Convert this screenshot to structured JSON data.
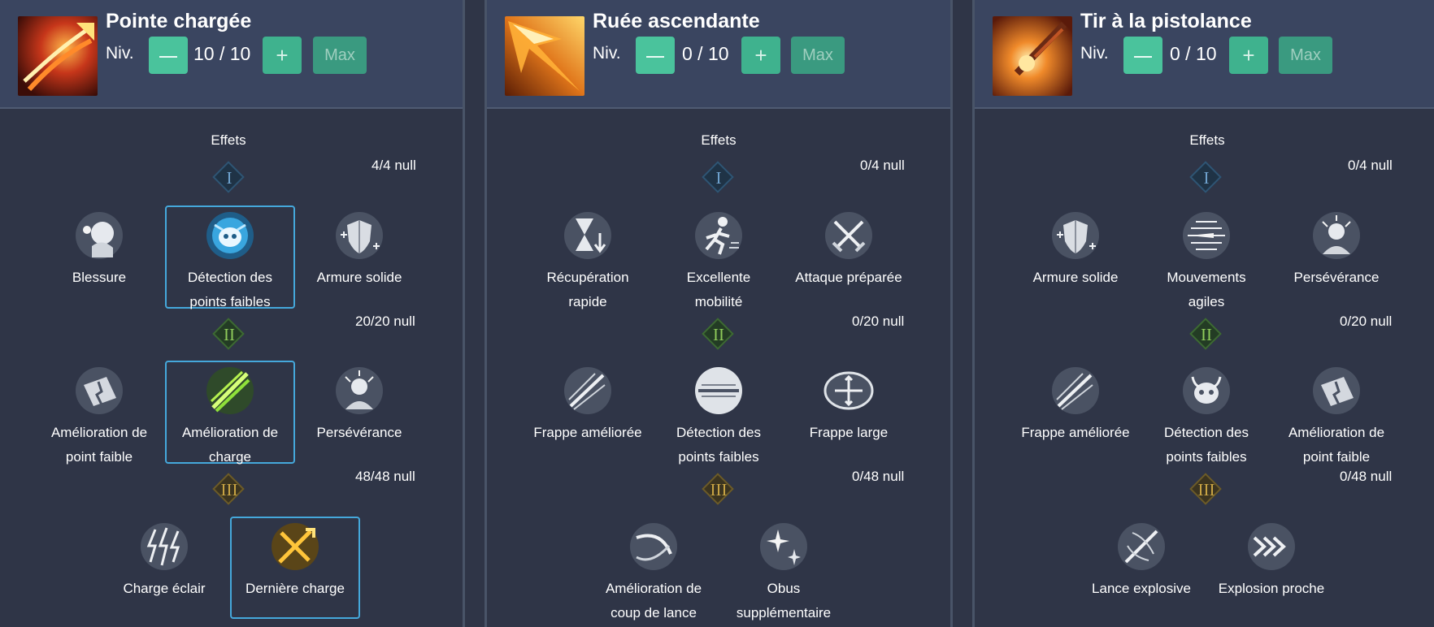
{
  "colors": {
    "background": "#2f3547",
    "header": "#3a4560",
    "button": "#3fb28e",
    "selected_border": "#45a8db"
  },
  "controls": {
    "minus": "-",
    "plus": "+",
    "max": "Max",
    "level_prefix": "Niv.",
    "effects_label": "Effets"
  },
  "tier_numerals": [
    "I",
    "II",
    "III"
  ],
  "panels": [
    {
      "title": "Pointe chargée",
      "icon": "flame-thrust-icon",
      "level": "10 / 10",
      "points": [
        "4/4 null",
        "20/20 null",
        "48/48 null"
      ],
      "tiers": [
        [
          "Blessure",
          "Détection des\npoints faibles",
          "Armure solide"
        ],
        [
          "Amélioration de\npoint faible",
          "Amélioration de\ncharge",
          "Persévérance"
        ],
        [
          "Charge éclair",
          "Dernière charge"
        ]
      ]
    },
    {
      "title": "Ruée ascendante",
      "icon": "rising-rush-icon",
      "level": "0 / 10",
      "points": [
        "0/4 null",
        "0/20 null",
        "0/48 null"
      ],
      "tiers": [
        [
          "Récupération\nrapide",
          "Excellente\nmobilité",
          "Attaque préparée"
        ],
        [
          "Frappe améliorée",
          "Détection des\npoints faibles",
          "Frappe large"
        ],
        [
          "Amélioration de\ncoup de lance",
          "Obus\nsupplémentaire"
        ]
      ]
    },
    {
      "title": "Tir à la pistolance",
      "icon": "gunlance-shot-icon",
      "level": "0 / 10",
      "points": [
        "0/4 null",
        "0/20 null",
        "0/48 null"
      ],
      "tiers": [
        [
          "Armure solide",
          "Mouvements\nagiles",
          "Persévérance"
        ],
        [
          "Frappe améliorée",
          "Détection des\npoints faibles",
          "Amélioration de\npoint faible"
        ],
        [
          "Lance explosive",
          "Explosion proche"
        ]
      ]
    }
  ]
}
